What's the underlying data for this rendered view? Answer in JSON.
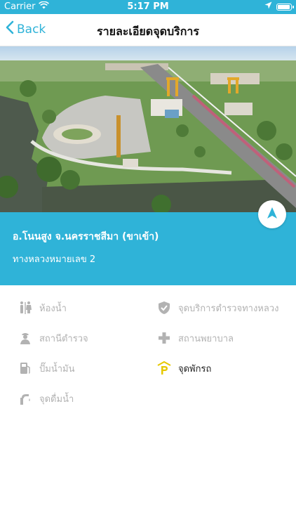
{
  "status_bar": {
    "carrier": "Carrier",
    "time": "5:17 PM",
    "battery_level": 0.85
  },
  "nav": {
    "back_label": "Back",
    "title": "รายละเอียดจุดบริการ"
  },
  "service_point": {
    "name": "อ.โนนสูง จ.นครราชสีมา (ขาเข้า)",
    "road": "ทางหลวงหมายเลข 2"
  },
  "facilities": [
    {
      "label": "ห้องน้ำ",
      "icon": "restroom-icon",
      "available": false
    },
    {
      "label": "จุดบริการตำรวจทางหลวง",
      "icon": "police-shield-icon",
      "available": false
    },
    {
      "label": "สถานีตำรวจ",
      "icon": "police-officer-icon",
      "available": false
    },
    {
      "label": "สถานพยาบาล",
      "icon": "medical-cross-icon",
      "available": false
    },
    {
      "label": "ปั๊มน้ำมัน",
      "icon": "fuel-pump-icon",
      "available": false
    },
    {
      "label": "จุดพักรถ",
      "icon": "parking-icon",
      "available": true
    },
    {
      "label": "จุดดื่มน้ำ",
      "icon": "drinking-water-icon",
      "available": false
    }
  ],
  "colors": {
    "primary": "#2fb3d8",
    "inactive": "#b2b2b2",
    "parking_accent": "#e6c800"
  }
}
